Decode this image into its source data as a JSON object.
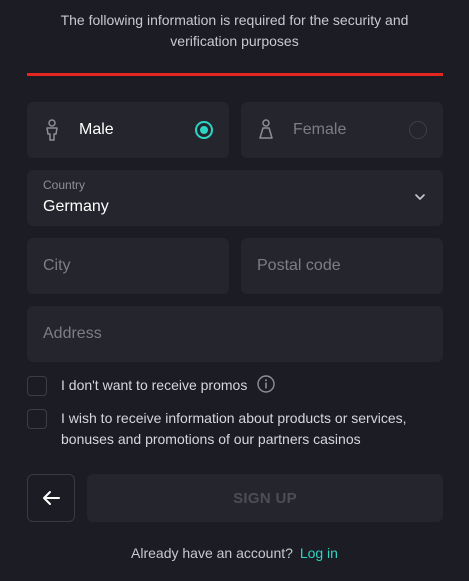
{
  "intro_text": "The following information is required for the security and verification purposes",
  "gender": {
    "male": {
      "label": "Male",
      "icon": "male-person-icon",
      "selected": true
    },
    "female": {
      "label": "Female",
      "icon": "female-person-icon",
      "selected": false
    }
  },
  "country": {
    "label": "Country",
    "value": "Germany",
    "icon": "chevron-down-icon"
  },
  "fields": {
    "city_placeholder": "City",
    "postal_placeholder": "Postal code",
    "address_placeholder": "Address"
  },
  "checkboxes": {
    "promos_label": "I don't want to receive promos",
    "partners_label": "I wish to receive information about products or services, bonuses and promotions of our partners casinos"
  },
  "actions": {
    "back_icon": "arrow-left-icon",
    "signup_label": "SIGN UP"
  },
  "footer": {
    "prompt": "Already have an account?",
    "login_link": "Log in"
  },
  "colors": {
    "accent": "#2dd4c4",
    "divider": "#e3261f",
    "background": "#1c1c24",
    "field": "#25252e"
  }
}
